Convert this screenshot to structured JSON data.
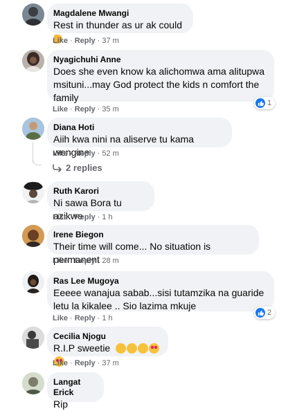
{
  "meta": {
    "like_label": "Like",
    "reply_label": "Reply",
    "separator": "·"
  },
  "comments": [
    {
      "author": "Magdalene Mwangi",
      "text": "Rest in thunder as ur ak could",
      "text_emoji": "flexed-biceps",
      "time": "37 m"
    },
    {
      "author": "Nyagichuhi Anne",
      "text": "Does she even know ka alichomwa ama alitupwa msituni...may God protect the kids n comfort the family",
      "time": "35 m",
      "reaction_count": "1"
    },
    {
      "author": "Diana Hoti",
      "text": "Aiih kwa nini na aliserve tu kama wengine",
      "time": "52 m",
      "replies_label": "2 replies"
    },
    {
      "author": "Ruth Karori",
      "text": "Ni sawa Bora tu azikwe",
      "time": "1 h"
    },
    {
      "author": "Irene Biegon",
      "text": "Their time will come... No situation is permanent",
      "time": "28 m"
    },
    {
      "author": "Ras Lee Mugoya",
      "text": "Eeeee wanajua sabab...sisi tutamzika na guaride letu la kikalee .. Sio lazima mkuje",
      "time": "1 h",
      "reaction_count": "2"
    },
    {
      "author": "Cecilia Njogu",
      "text": "R.I.P sweetie",
      "emojis": [
        "pleading-face",
        "pleading-face",
        "pleading-face",
        "heart-eyes-face",
        "heart-eyes-face"
      ],
      "time": "37 m"
    },
    {
      "author": "Langat Erick",
      "text": "Rip"
    }
  ],
  "colors": {
    "bubble": "#f0f2f5",
    "meta_text": "#65676b",
    "like_blue": "#1877f2"
  }
}
